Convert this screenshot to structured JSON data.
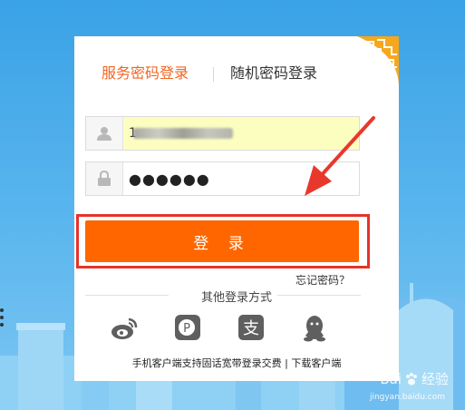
{
  "tabs": {
    "active": "服务密码登录",
    "other": "随机密码登录"
  },
  "username": {
    "icon": "user-icon",
    "value": "1"
  },
  "password": {
    "icon": "lock-icon",
    "value": "●●●●●●"
  },
  "login_button": "登 录",
  "forgot_link": "忘记密码？",
  "other_methods": {
    "label": "其他登录方式",
    "icons": [
      "weibo-icon",
      "pay-icon",
      "alipay-icon",
      "qq-icon"
    ]
  },
  "footer": {
    "text": "手机客户端支持固话宽带登录交费",
    "separator": " | ",
    "link": "下载客户端"
  },
  "watermark": {
    "brand": "Bai",
    "suffix": "经验",
    "url": "jingyan.baidu.com"
  },
  "colors": {
    "accent": "#ff6600",
    "tab_active": "#f26522",
    "highlight_border": "#e63329",
    "autofill_bg": "#fcfec0"
  }
}
